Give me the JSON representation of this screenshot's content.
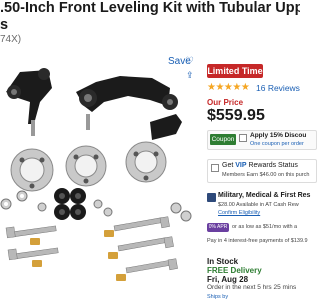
{
  "product": {
    "title": ".50-Inch Front Leveling Kit with Tubular Upper",
    "title_line2": "s",
    "part_fragment": "74X)"
  },
  "actions": {
    "save_label": "Save",
    "save_icon": "heart-icon",
    "share_icon": "share-icon"
  },
  "badge": {
    "label": "Limited Time",
    "color": "#c62828"
  },
  "rating": {
    "stars": "★★★★★",
    "reviews_label": "16 Reviews",
    "star_color": "#f5a623"
  },
  "pricing": {
    "our_price_label": "Our Price",
    "price": "$559.95"
  },
  "coupon": {
    "chip": "Coupon",
    "text": "Apply 15% Discou",
    "sub": "One coupon per order"
  },
  "vip": {
    "title_prefix": "Get ",
    "title_emph": "VIP",
    "title_suffix": " Rewards Status",
    "sub": "Members Earn $46.00 on this purch"
  },
  "military": {
    "title": "Military, Medical & First Res",
    "line": "$28.00 Available in AT Cash Rew",
    "link": "Confirm Eligibility"
  },
  "financing": {
    "chip": "0% APR",
    "text": "or as low as $51/mo with a"
  },
  "pay_in_4": "Pay in 4 interest-free payments of $139.9",
  "delivery": {
    "in_stock": "In Stock",
    "free_delivery": "FREE Delivery",
    "date": "Fri, Aug 28",
    "order_in": "Order in the next 5 hrs 25 mins",
    "ship_by": "Ships by"
  },
  "colors": {
    "accent": "#1a5fb4",
    "sale": "#c62828",
    "stock": "#2e7d32"
  }
}
